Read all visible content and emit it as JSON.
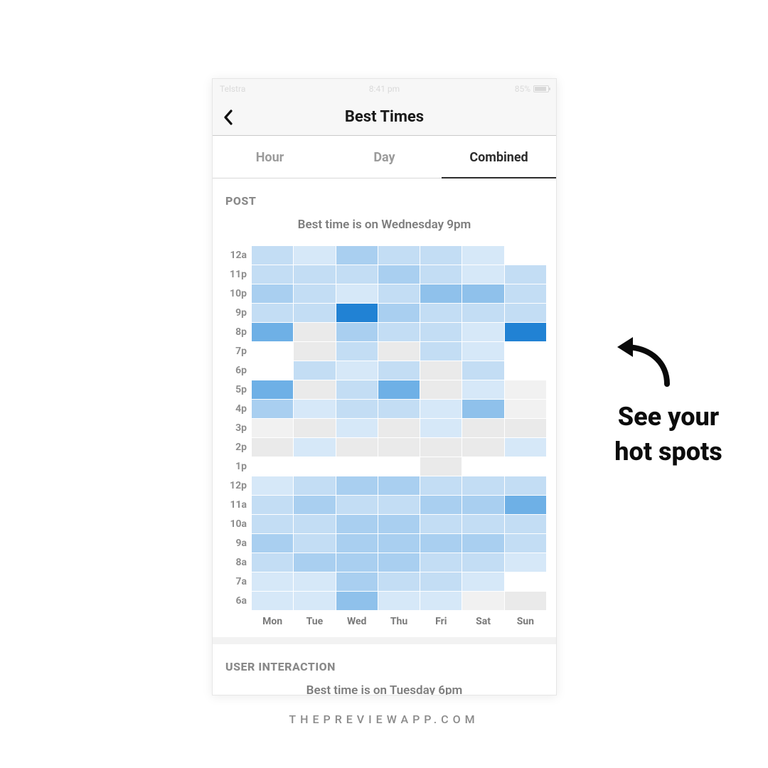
{
  "status": {
    "carrier": "Telstra",
    "time": "8:41 pm",
    "battery_pct": "85%"
  },
  "nav": {
    "title": "Best Times"
  },
  "tabs": {
    "items": [
      "Hour",
      "Day",
      "Combined"
    ],
    "active_index": 2
  },
  "post": {
    "head": "POST",
    "subtitle": "Best time is on Wednesday 9pm"
  },
  "interaction": {
    "head": "USER INTERACTION",
    "subtitle": "Best time is on Tuesday 6pm"
  },
  "annotation": {
    "line1": "See your",
    "line2": "hot spots"
  },
  "footer": "THEPREVIEWAPP.COM",
  "chart_data": {
    "type": "heatmap",
    "title": "Best time is on Wednesday 9pm",
    "xlabel": "",
    "ylabel": "",
    "x_categories": [
      "Mon",
      "Tue",
      "Wed",
      "Thu",
      "Fri",
      "Sat",
      "Sun"
    ],
    "y_categories": [
      "12a",
      "11p",
      "10p",
      "9p",
      "8p",
      "7p",
      "6p",
      "5p",
      "4p",
      "3p",
      "2p",
      "1p",
      "12p",
      "11a",
      "10a",
      "9a",
      "8a",
      "7a",
      "6a"
    ],
    "values": [
      [
        5,
        4,
        6,
        5,
        5,
        4,
        0
      ],
      [
        5,
        5,
        5,
        6,
        5,
        4,
        5
      ],
      [
        6,
        5,
        4,
        5,
        7,
        7,
        5
      ],
      [
        5,
        5,
        10,
        6,
        5,
        5,
        5
      ],
      [
        8,
        2,
        6,
        5,
        5,
        4,
        10
      ],
      [
        0,
        2,
        5,
        2,
        5,
        4,
        0
      ],
      [
        0,
        5,
        4,
        5,
        2,
        5,
        0
      ],
      [
        8,
        2,
        5,
        8,
        2,
        4,
        1
      ],
      [
        6,
        4,
        5,
        5,
        4,
        7,
        1
      ],
      [
        1,
        2,
        4,
        2,
        4,
        2,
        2
      ],
      [
        2,
        4,
        2,
        2,
        2,
        2,
        4
      ],
      [
        0,
        0,
        0,
        0,
        2,
        0,
        0
      ],
      [
        4,
        5,
        6,
        6,
        5,
        5,
        5
      ],
      [
        5,
        6,
        5,
        5,
        6,
        6,
        8
      ],
      [
        5,
        5,
        6,
        6,
        5,
        5,
        5
      ],
      [
        6,
        5,
        6,
        6,
        6,
        6,
        5
      ],
      [
        5,
        6,
        6,
        6,
        5,
        5,
        4
      ],
      [
        4,
        4,
        6,
        5,
        5,
        4,
        0
      ],
      [
        4,
        4,
        7,
        4,
        4,
        1,
        2
      ]
    ],
    "scale_note": "0=white/none, 1-2=light grey, 3-5=pale blue, 6-8=medium blue, 9-10=strong blue (10 ≈ hottest)"
  }
}
